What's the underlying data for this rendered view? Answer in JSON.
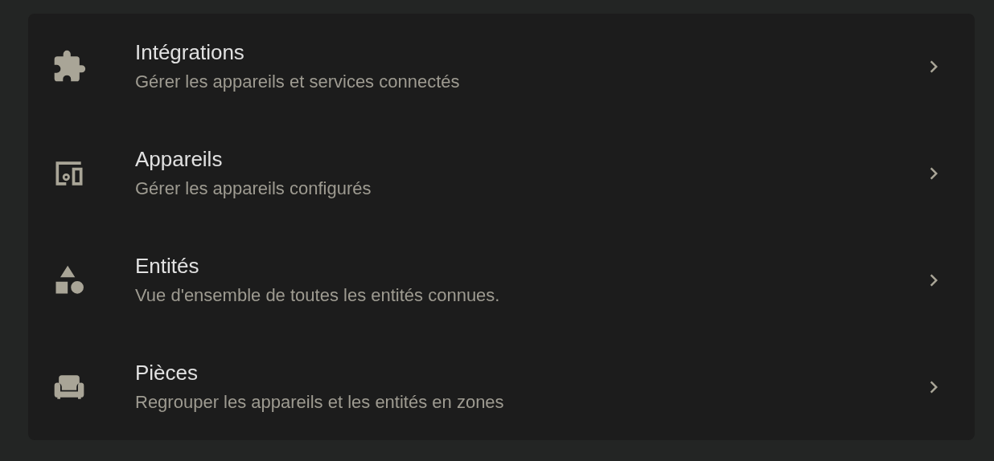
{
  "menu": [
    {
      "title": "Intégrations",
      "subtitle": "Gérer les appareils et services connectés"
    },
    {
      "title": "Appareils",
      "subtitle": "Gérer les appareils configurés"
    },
    {
      "title": "Entités",
      "subtitle": "Vue d'ensemble de toutes les entités connues."
    },
    {
      "title": "Pièces",
      "subtitle": "Regrouper les appareils et les entités en zones"
    }
  ]
}
